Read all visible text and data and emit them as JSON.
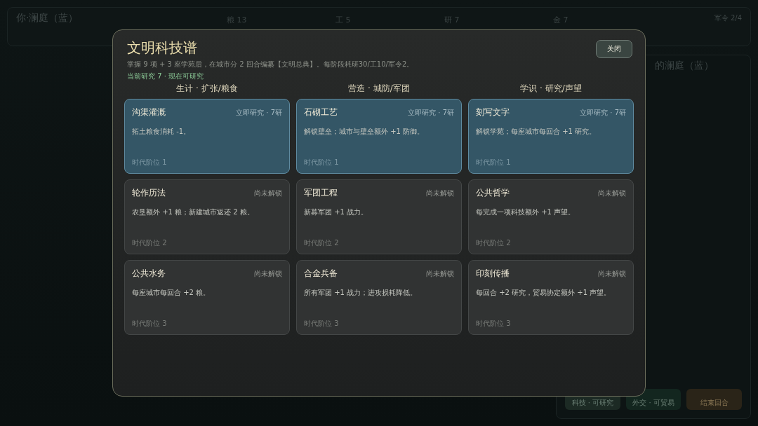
{
  "top_bar": {
    "player": "你·澜庭（蓝）",
    "resources": [
      "粮 13",
      "工 5",
      "研 7",
      "金 7"
    ],
    "orders": "军令 2/4"
  },
  "side_panel": {
    "title": "的澜庭（蓝）",
    "buttons": [
      {
        "label": "科技 · 可研究",
        "kind": "research"
      },
      {
        "label": "外交 · 可贸易",
        "kind": "diplomacy"
      },
      {
        "label": "结束回合",
        "kind": "end"
      }
    ]
  },
  "modal": {
    "title": "文明科技谱",
    "subtitle": "掌握 9 项 + 3 座学苑后，在城市分 2 回合编纂【文明总典】。每阶段耗研30/工10/军令2。",
    "current": "当前研究 7 · 现在可研究",
    "close": "关闭",
    "columns": [
      {
        "heading": "生计 · 扩张/粮食",
        "techs": [
          {
            "name": "沟渠灌溉",
            "status": "立即研究 · 7研",
            "description": "拓土粮食消耗 -1。",
            "era": "时代阶位 1",
            "available": true
          },
          {
            "name": "轮作历法",
            "status": "尚未解锁",
            "description": "农垦额外 +1 粮；新建城市返还 2 粮。",
            "era": "时代阶位 2",
            "available": false
          },
          {
            "name": "公共水务",
            "status": "尚未解锁",
            "description": "每座城市每回合 +2 粮。",
            "era": "时代阶位 3",
            "available": false
          }
        ]
      },
      {
        "heading": "营造 · 城防/军团",
        "techs": [
          {
            "name": "石砌工艺",
            "status": "立即研究 · 7研",
            "description": "解锁壁垒；城市与壁垒额外 +1 防御。",
            "era": "时代阶位 1",
            "available": true
          },
          {
            "name": "军团工程",
            "status": "尚未解锁",
            "description": "新募军团 +1 战力。",
            "era": "时代阶位 2",
            "available": false
          },
          {
            "name": "合金兵备",
            "status": "尚未解锁",
            "description": "所有军团 +1 战力；进攻损耗降低。",
            "era": "时代阶位 3",
            "available": false
          }
        ]
      },
      {
        "heading": "学识 · 研究/声望",
        "techs": [
          {
            "name": "刻写文字",
            "status": "立即研究 · 7研",
            "description": "解锁学苑；每座城市每回合 +1 研究。",
            "era": "时代阶位 1",
            "available": true
          },
          {
            "name": "公共哲学",
            "status": "尚未解锁",
            "description": "每完成一项科技额外 +1 声望。",
            "era": "时代阶位 2",
            "available": false
          },
          {
            "name": "印刻传播",
            "status": "尚未解锁",
            "description": "每回合 +2 研究，贸易协定额外 +1 声望。",
            "era": "时代阶位 3",
            "available": false
          }
        ]
      }
    ]
  }
}
